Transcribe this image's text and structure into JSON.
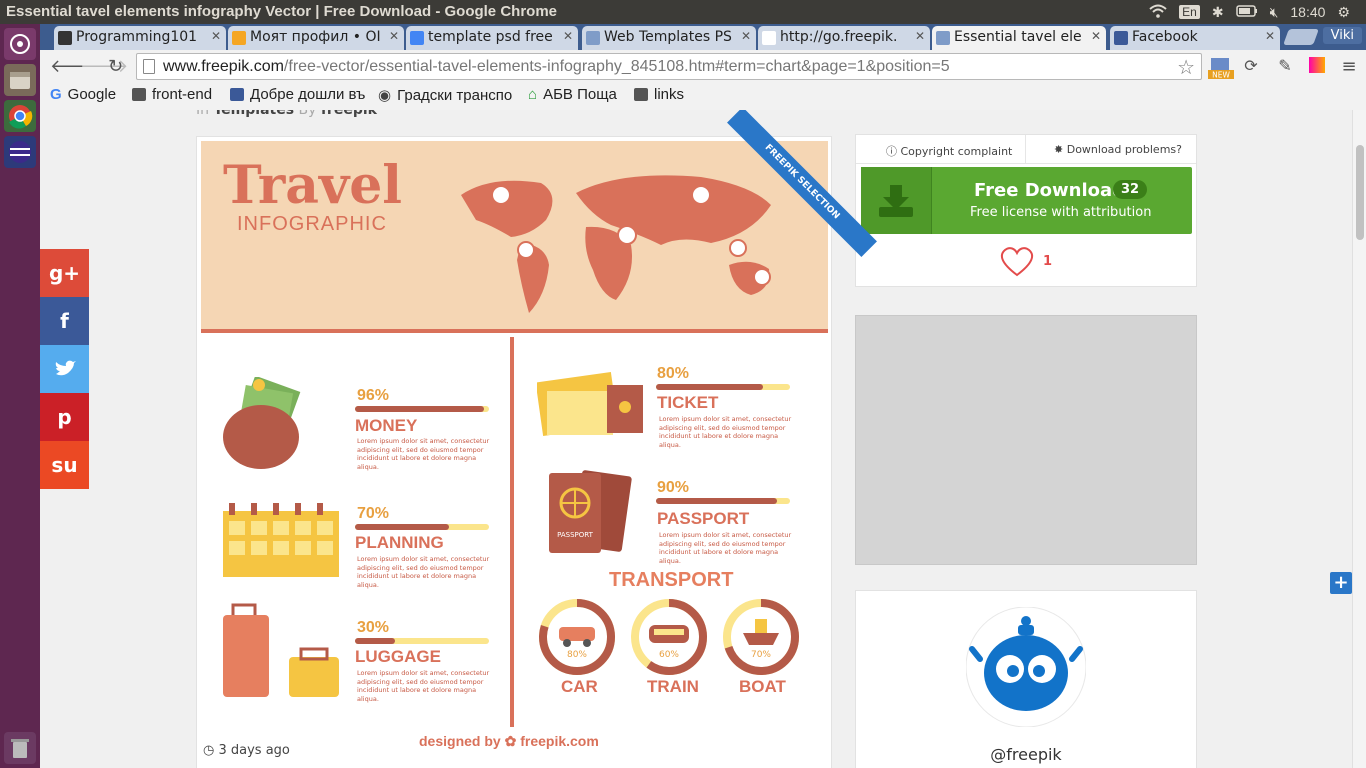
{
  "os": {
    "window_title": "Essential tavel elements infography Vector | Free Download - Google Chrome",
    "keyboard": "En",
    "time": "18:40"
  },
  "tabs": [
    {
      "label": "Programming101",
      "favicon": "github-icon",
      "color": "#333333"
    },
    {
      "label": "Моят профил • OI",
      "favicon": "olx-icon",
      "color": "#f5a623"
    },
    {
      "label": "template psd free",
      "favicon": "google-icon",
      "color": "#4285f4"
    },
    {
      "label": "Web Templates PS",
      "favicon": "page-icon",
      "color": "#7f9cc8"
    },
    {
      "label": "http://go.freepik.",
      "favicon": "page-icon",
      "color": "#ffffff"
    },
    {
      "label": "Essential tavel ele",
      "favicon": "page-icon",
      "color": "#7f9cc8"
    },
    {
      "label": "Facebook",
      "favicon": "facebook-icon",
      "color": "#3b5998"
    }
  ],
  "profile_name": "Viki",
  "omnibox": {
    "host": "www.freepik.com",
    "path": "/free-vector/essential-tavel-elements-infography_845108.htm#term=chart&page=1&position=5"
  },
  "extension_badge": "NEW",
  "bookmarks": [
    {
      "label": "Google",
      "icon": "google-icon",
      "color": "#4285f4"
    },
    {
      "label": "front-end",
      "icon": "folder-icon",
      "color": "#555555"
    },
    {
      "label": "Добре дошли въ",
      "icon": "facebook-icon",
      "color": "#3b5998"
    },
    {
      "label": "Градски транспо",
      "icon": "bus-icon",
      "color": "#444444"
    },
    {
      "label": "АБВ Поща",
      "icon": "home-icon",
      "color": "#2e9e3e"
    },
    {
      "label": "links",
      "icon": "folder-icon",
      "color": "#555555"
    }
  ],
  "page": {
    "meta_in": "In",
    "meta_category": "Templates",
    "meta_by": "By",
    "meta_author": "freepik",
    "ribbon": "FREEPIK SELECTION",
    "posted": "3 days ago",
    "infographic": {
      "title": "Travel",
      "subtitle": "INFOGRAPHIC",
      "lorem": "Lorem ipsum dolor sit amet, consectetur adipiscing elit, sed do eiusmod tempor incididunt ut labore et dolore magna aliqua.",
      "left": [
        {
          "pct": "96%",
          "label": "MONEY",
          "level": 0.96
        },
        {
          "pct": "70%",
          "label": "PLANNING",
          "level": 0.7
        },
        {
          "pct": "30%",
          "label": "LUGGAGE",
          "level": 0.3
        }
      ],
      "right": [
        {
          "pct": "80%",
          "label": "TICKET",
          "level": 0.8
        },
        {
          "pct": "90%",
          "label": "PASSPORT",
          "level": 0.9
        }
      ],
      "passport_text": "PASSPORT",
      "transport_title": "TRANSPORT",
      "transport": [
        {
          "pct": "80%",
          "label": "CAR",
          "level": 0.8
        },
        {
          "pct": "60%",
          "label": "TRAIN",
          "level": 0.6
        },
        {
          "pct": "70%",
          "label": "BOAT",
          "level": 0.7
        }
      ],
      "designed_by": "designed by",
      "brand": "freepik.com"
    },
    "copyright": "Copyright complaint",
    "download_problems": "Download problems?",
    "download_label": "Free Download",
    "download_count": "32",
    "license": "Free license with attribution",
    "likes": "1",
    "author_handle": "@freepik"
  },
  "share": [
    {
      "label": "g+",
      "icon": "google-plus-icon",
      "color": "#dd4b39"
    },
    {
      "label": "f",
      "icon": "facebook-icon",
      "color": "#3b5998"
    },
    {
      "label": "t",
      "icon": "twitter-icon",
      "color": "#55acee"
    },
    {
      "label": "p",
      "icon": "pinterest-icon",
      "color": "#cb2027"
    },
    {
      "label": "su",
      "icon": "stumbleupon-icon",
      "color": "#eb4924"
    }
  ]
}
